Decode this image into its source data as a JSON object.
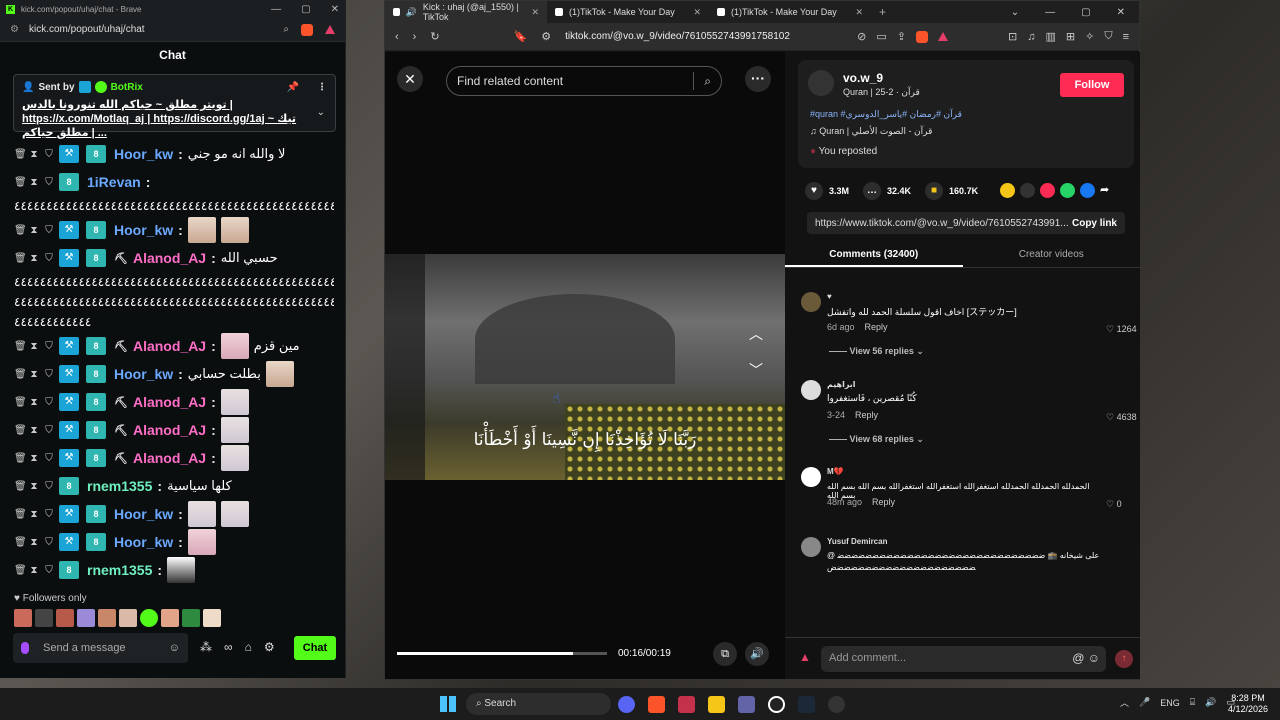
{
  "kick_window": {
    "title": "kick.com/popout/uhaj/chat - Brave",
    "url": "kick.com/popout/uhaj/chat",
    "chat_header": "Chat",
    "pinned": {
      "sent_by_label": "Sent by",
      "sender": "BotRix",
      "text": "تويتر مطلق ~ حياكم الله تنورونا بالدس | https://x.com/Motlaq_aj | https://discord.gg/1aj ~ تيك مطلق حياكم | ..."
    },
    "messages": [
      {
        "user": "Hoor_kw",
        "color": "blue",
        "text": "لا والله انه مو جني",
        "emotes": 0
      },
      {
        "user": "1iRevan",
        "color": "blue",
        "text": "",
        "emotes": 0
      },
      {
        "user": "Hoor_kw",
        "color": "blue",
        "text": "",
        "emotes": 2
      },
      {
        "user": "Alanod_AJ",
        "color": "pink",
        "text": "حسبي الله",
        "emotes": 0
      },
      {
        "user": "Alanod_AJ",
        "color": "pink",
        "text": "مين قزم",
        "emotes": 1
      },
      {
        "user": "Hoor_kw",
        "color": "blue",
        "text": "بطلت حسابي",
        "emotes": 1
      },
      {
        "user": "Alanod_AJ",
        "color": "pink",
        "text": "",
        "emotes": 1
      },
      {
        "user": "Alanod_AJ",
        "color": "pink",
        "text": "",
        "emotes": 1
      },
      {
        "user": "Alanod_AJ",
        "color": "pink",
        "text": "",
        "emotes": 1
      },
      {
        "user": "rnem1355",
        "color": "green",
        "text": "كلها سياسية",
        "emotes": 0
      },
      {
        "user": "Hoor_kw",
        "color": "blue",
        "text": "",
        "emotes": 2
      },
      {
        "user": "Hoor_kw",
        "color": "blue",
        "text": "",
        "emotes": 1
      },
      {
        "user": "rnem1355",
        "color": "green",
        "text": "",
        "emotes": 1
      }
    ],
    "spam_line_1": "٤٤٤٤٤٤٤٤٤٤٤٤٤٤٤٤٤٤٤٤٤٤٤٤٤٤٤٤٤٤٤٤٤٤٤٤٤٤٤٤٤٤٤٤٤٤٤٤٤٤٤٤",
    "spam_line_2": "٤٤٤٤٤٤٤٤٤٤٤٤٤٤٤٤٤٤٤٤٤٤٤٤٤٤٤٤٤٤٤٤٤٤٤٤٤٤٤٤٤٤٤٤٤٤٤٤٤٤٤٤٤٤٤",
    "spam_line_3": "٤٤٤٤٤٤٤٤٤٤٤٤٤٤٤٤٤٤٤٤٤٤٤٤٤٤٤٤٤٤٤٤٤٤٤٤٤٤٤٤٤٤٤٤٤٤٤٤٤٤٤٤٤٤٤",
    "spam_line_4": "٤٤٤٤٤٤٤٤٤٤٤٤",
    "followers_only": "Followers only",
    "send_placeholder": "Send a message",
    "chat_button": "Chat",
    "accent": "#53fc18"
  },
  "tiktok_window": {
    "tabs": [
      {
        "label": "Kick : uhaj (@aj_1550) | TikTok",
        "active": true
      },
      {
        "label": "(1)TikTok - Make Your Day",
        "active": false
      },
      {
        "label": "(1)TikTok - Make Your Day",
        "active": false
      }
    ],
    "url": "tiktok.com/@vo.w_9/video/7610552743991758102",
    "search_placeholder": "Find related content",
    "subtitle": "رَبَّنَا لَا تُؤَاخِذْنَا إِن نَّسِينَا أَوْ أَخْطَأْنَا",
    "progress": 0.84,
    "time": "00:16/00:19",
    "author": {
      "name": "vo.w_9",
      "subtitle": "Quran | قرآن · 2-25",
      "follow_label": "Follow",
      "hashtags": "#quran #قرآن #رمضان #ياسر_الدوسري",
      "sound": "Quran | قرآن - الصوت الأصلي",
      "reposted": "You reposted"
    },
    "stats": {
      "likes": "3.3M",
      "comments": "32.4K",
      "saves": "160.7K"
    },
    "link": "https://www.tiktok.com/@vo.w_9/video/7610552743991...",
    "copy_link": "Copy link",
    "tab_comments": "Comments (32400)",
    "tab_creator": "Creator videos",
    "comments": [
      {
        "name": "♥",
        "text": "اخاف اقول سلسلة الحمد لله واتفشل [ステッカー]",
        "time": "6d ago",
        "likes": "1264",
        "replies": "View 56 replies"
      },
      {
        "name": "ابراهيم",
        "text": "كُنّا مُقصرين ، فَاستغفروا",
        "time": "3-24",
        "likes": "4638",
        "replies": "View 68 replies"
      },
      {
        "name": "M💔",
        "text": "الحمدلله الحمدلله الحمدلله استغفرالله استغفرالله استغفرالله بسم الله بسم الله بسم الله",
        "time": "48m ago",
        "likes": "0",
        "replies": ""
      },
      {
        "name": "Yusuf Demircan",
        "text": "@ على شيخانه 🕋 ضضضضضضضضضضضضضضضضضضضضضضضضضضضضضضضضضضضضضضضضضضضضضضضضضضض",
        "time": "",
        "likes": "",
        "replies": ""
      }
    ],
    "reply_label": "Reply",
    "comment_placeholder": "Add comment..."
  },
  "taskbar": {
    "search": "Search",
    "lang": "ENG",
    "time": "8:28 PM",
    "date": "4/12/2026"
  }
}
